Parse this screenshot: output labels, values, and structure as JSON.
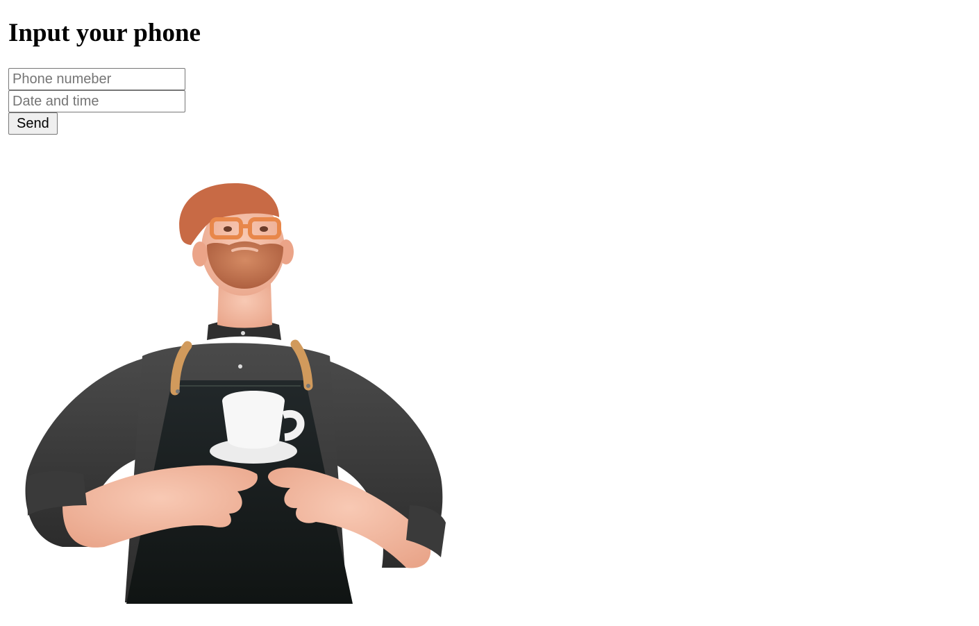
{
  "heading": "Input your phone",
  "form": {
    "phone_placeholder": "Phone numeber",
    "datetime_placeholder": "Date and time",
    "send_label": "Send"
  },
  "illustration": {
    "icon": "barista-illustration",
    "colors": {
      "shirt": "#3d3d3d",
      "apron": "#1b1f1d",
      "skin": "#f2b49b",
      "hair": "#c86a45",
      "beard": "#c97a55",
      "glasses": "#e8874a",
      "strap": "#d19a5c",
      "cup": "#f4f4f4"
    }
  }
}
